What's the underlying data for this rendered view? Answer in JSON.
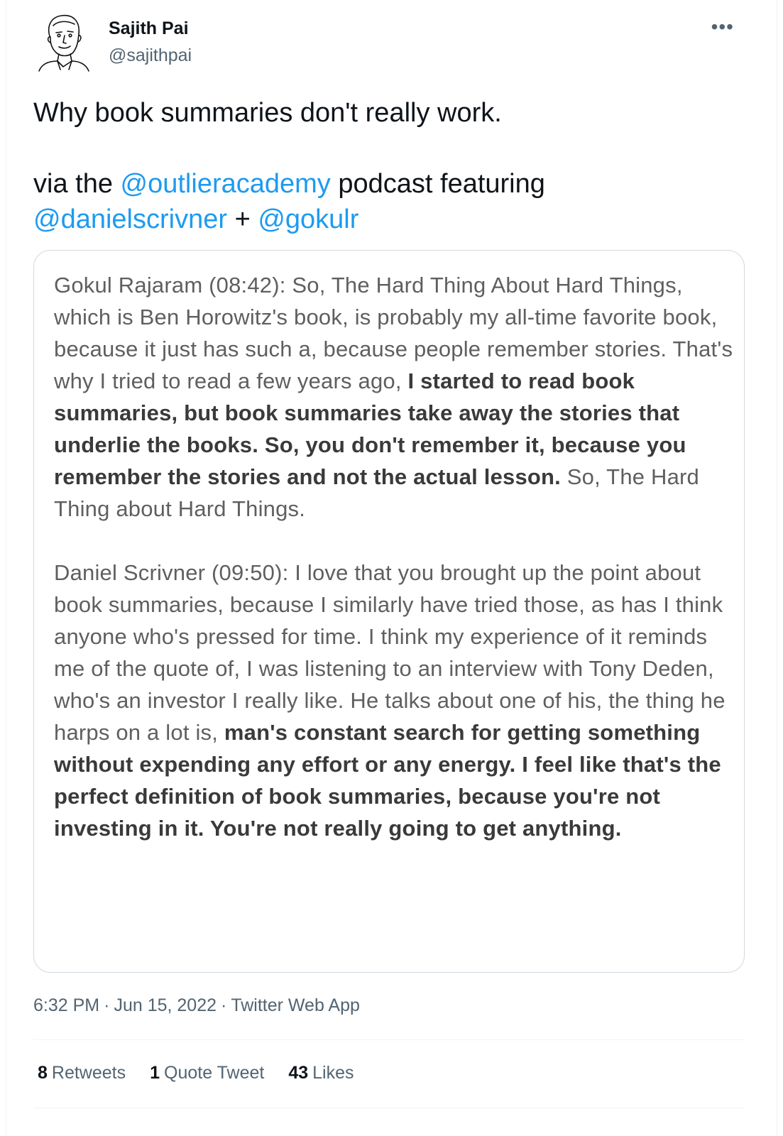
{
  "author": {
    "name": "Sajith Pai",
    "handle": "@sajithpai"
  },
  "tweet": {
    "line1": "Why book summaries don't really work.",
    "line2_pre": "via the ",
    "mention1": "@outlieracademy",
    "line2_post": " podcast featuring",
    "mention2": "@danielscrivner",
    "plus": " + ",
    "mention3": "@gokulr"
  },
  "quote": {
    "p1_plain": "Gokul Rajaram (08:42): So, The Hard Thing About Hard Things, which is Ben Horowitz's book, is probably my all-time favorite book, because it just has such a, because people remember stories. That's why I tried to read a few years ago, ",
    "p1_bold": "I started to read book summaries, but book summaries take away the stories that underlie the books. So, you don't remember it, because you remember the stories and not the actual lesson.",
    "p1_tail": " So, The Hard Thing about Hard Things.",
    "p2_plain": "Daniel Scrivner (09:50):  I love that you brought up the point about book summaries, because I similarly have tried those, as has I think anyone who's pressed for time. I think my experience of it reminds me of the quote of, I was listening to an interview with Tony Deden, who's an investor I really like. He talks about one of his, the thing he harps on a lot is, ",
    "p2_bold": "man's constant search for getting something without expending any effort or any energy. I feel like that's the perfect definition of book summaries, because you're not investing in it. You're not really going to get anything."
  },
  "meta": {
    "time": "6:32 PM",
    "sep": "·",
    "date": "Jun 15, 2022",
    "source": "Twitter Web App"
  },
  "stats": {
    "retweets_count": "8",
    "retweets_label": "Retweets",
    "quotes_count": "1",
    "quotes_label": "Quote Tweet",
    "likes_count": "43",
    "likes_label": "Likes"
  },
  "icons": {
    "avatar": "sketch-portrait-avatar",
    "more": "more-options-icon"
  },
  "colors": {
    "accent": "#1d9bf0",
    "text": "#0f1419",
    "secondary": "#536471",
    "border": "#cfd9de"
  }
}
